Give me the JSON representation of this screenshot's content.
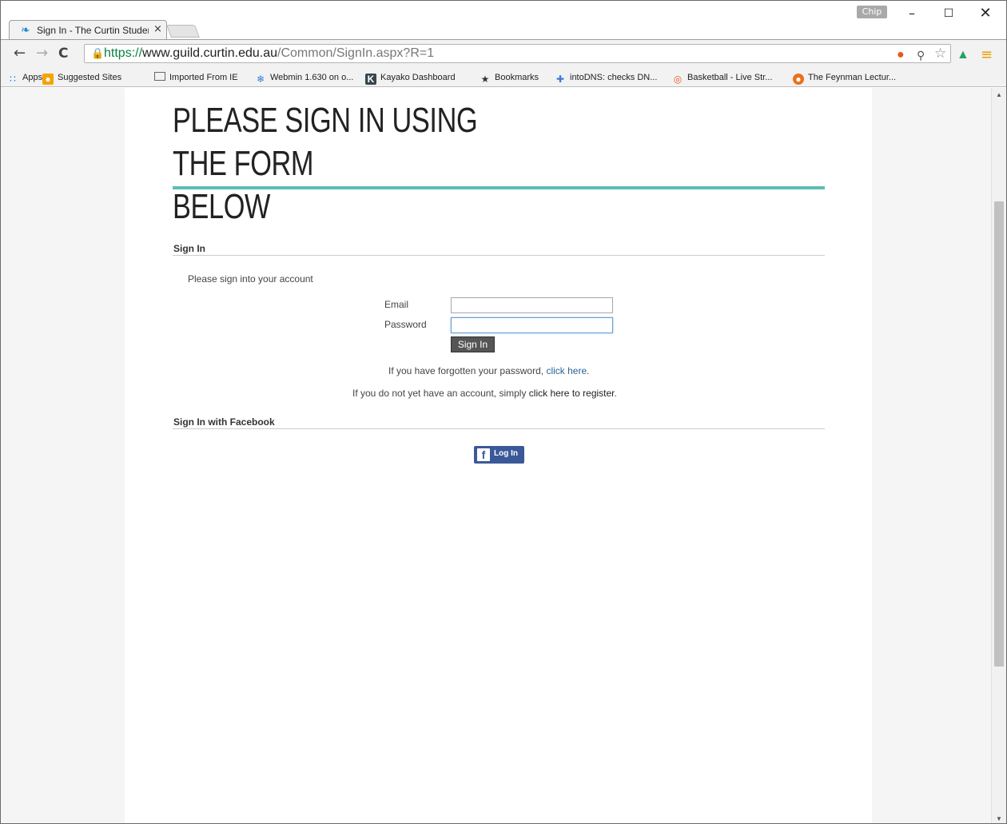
{
  "browser": {
    "profile_badge": "Chip",
    "tab": {
      "title": "Sign In - The Curtin Student Guild",
      "close": "×"
    },
    "window_controls": {
      "minimize": "–",
      "maximize": "☐",
      "close": "✕"
    },
    "nav": {
      "back": "←",
      "forward": "→",
      "reload": "C"
    },
    "url": {
      "scheme": "https://",
      "host": "www.guild.curtin.edu.au",
      "path": "/Common/SignIn.aspx?R=1"
    },
    "bookmarks": [
      {
        "label": "Apps",
        "icon": "apps-grid-icon"
      },
      {
        "label": "Suggested Sites",
        "icon": "suggested-sites-icon"
      },
      {
        "label": "Imported From IE",
        "icon": "folder-icon"
      },
      {
        "label": "Webmin 1.630 on o...",
        "icon": "webmin-icon"
      },
      {
        "label": "Kayako Dashboard",
        "icon": "kayako-icon"
      },
      {
        "label": "Bookmarks",
        "icon": "star-icon"
      },
      {
        "label": "intoDNS: checks DN...",
        "icon": "intodns-icon"
      },
      {
        "label": "Basketball - Live Str...",
        "icon": "basketball-icon"
      },
      {
        "label": "The Feynman Lectur...",
        "icon": "feynman-icon"
      }
    ]
  },
  "page": {
    "heading_line1": "PLEASE SIGN IN USING THE FORM",
    "heading_line2": "BELOW",
    "accent_color": "#5bbfb7",
    "signin_section": {
      "title": "Sign In",
      "intro": "Please sign into your account",
      "email_label": "Email",
      "email_value": "",
      "password_label": "Password",
      "password_value": "",
      "button_label": "Sign In"
    },
    "forgot": {
      "prefix": "If you have forgotten your password, ",
      "link": "click here",
      "suffix": "."
    },
    "register": {
      "prefix": "If you do not yet have an account, simply ",
      "link": "click here to register",
      "suffix": "."
    },
    "facebook_section": {
      "title": "Sign In with Facebook",
      "button_label": "Log In",
      "brand_color": "#3b5998"
    }
  }
}
